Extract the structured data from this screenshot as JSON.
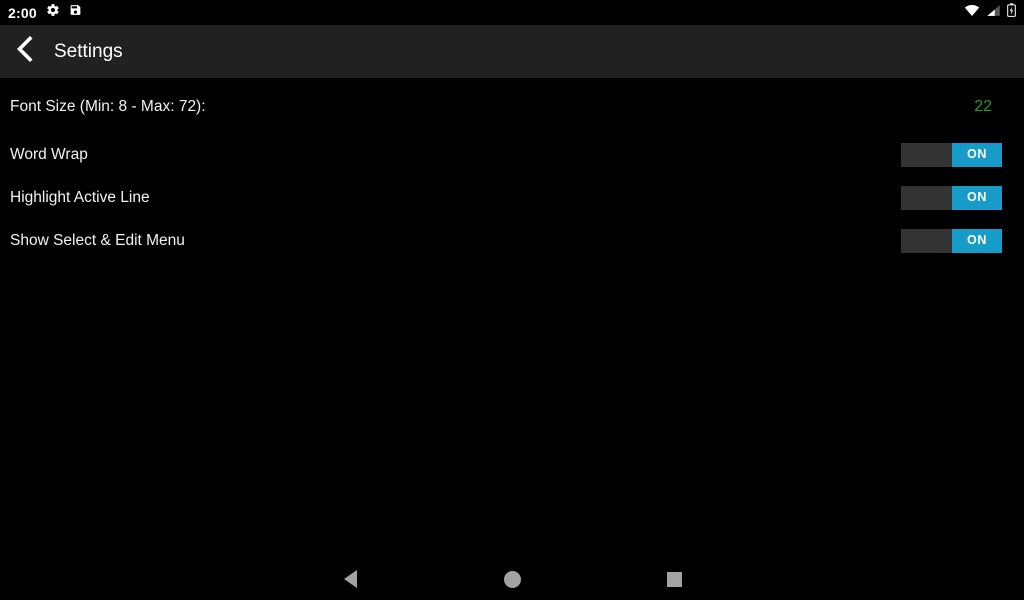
{
  "status_bar": {
    "clock": "2:00",
    "notification_icons": [
      "gear-icon",
      "save-icon"
    ],
    "system_icons": [
      "wifi-icon",
      "cellular-signal-icon",
      "battery-icon"
    ]
  },
  "app_bar": {
    "back_icon": "back-chevron-icon",
    "title": "Settings"
  },
  "settings": {
    "font_size_row": {
      "label": "Font Size (Min: 8 - Max: 72):",
      "value": "22"
    },
    "toggles": [
      {
        "label": "Word Wrap",
        "state": "ON"
      },
      {
        "label": "Highlight Active Line",
        "state": "ON"
      },
      {
        "label": "Show Select & Edit Menu",
        "state": "ON"
      }
    ]
  },
  "nav_bar": {
    "back": "back-triangle-icon",
    "home": "home-circle-icon",
    "recents": "recents-square-icon"
  },
  "colors": {
    "background": "#000000",
    "app_bar": "#212121",
    "toggle_on": "#179bc8",
    "toggle_track": "#333333",
    "value_green": "#1fa01f",
    "nav_icon": "#a3a3a3"
  }
}
